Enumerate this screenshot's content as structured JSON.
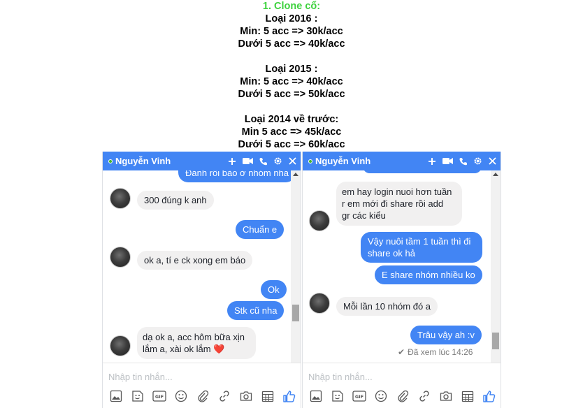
{
  "price_info": {
    "heading": "1. Clone cổ:",
    "groups": [
      {
        "title": "Loại 2016 :",
        "lines": [
          "Min: 5 acc => 30k/acc",
          "Dưới 5 acc => 40k/acc"
        ]
      },
      {
        "title": "Loại 2015 :",
        "lines": [
          "Min: 5 acc => 40k/acc",
          "Dưới 5 acc => 50k/acc"
        ]
      },
      {
        "title": "Loại 2014 về trước:",
        "lines": [
          "Min 5 acc => 45k/acc",
          "Dưới 5 acc => 60k/acc"
        ]
      }
    ]
  },
  "colors": {
    "header_blue": "#4285f4",
    "online_green": "#42b72a",
    "heading_green": "#3dd23d",
    "heart_red": "#e0245e"
  },
  "chat_left": {
    "contact_name": "Nguyễn Vinh",
    "partial_top": "Đánh rồi bào ở nhóm nha",
    "messages": [
      {
        "text": "300 đúng k anh"
      },
      {
        "text": "Chuẩn e"
      },
      {
        "text": "ok a, tí e ck xong em báo"
      },
      {
        "text": "Ok"
      },
      {
        "text": "Stk cũ nha"
      },
      {
        "text": "dạ ok a, acc hôm bữa xịn"
      },
      {
        "text": "lắm a, xài ok lắm"
      },
      {
        "text": "❤️"
      }
    ],
    "input_placeholder": "Nhập tin nhắn..."
  },
  "chat_right": {
    "contact_name": "Nguyễn Vinh",
    "messages": [
      {
        "text": "em hay login nuoi hơn tuần"
      },
      {
        "text": "r em mới đi share  rồi add"
      },
      {
        "text": "gr các kiểu"
      },
      {
        "text": "Vậy nuôi tầm 1 tuần thì đi"
      },
      {
        "text": "share ok hả"
      },
      {
        "text": "E share nhóm nhiều ko"
      },
      {
        "text": "Mỗi lần 10 nhóm đó a"
      },
      {
        "text": "Trâu vậy ah :v"
      }
    ],
    "seen_text": "Đã xem lúc 14:26",
    "input_placeholder": "Nhập tin nhắn..."
  },
  "toolbar_icons": [
    "image-icon",
    "sticker-icon",
    "gif-icon",
    "emoji-icon",
    "attachment-icon",
    "link-icon",
    "camera-icon",
    "calendar-icon",
    "like-icon"
  ],
  "header_icons": [
    "add-people-icon",
    "video-call-icon",
    "phone-icon",
    "settings-icon",
    "close-icon"
  ]
}
